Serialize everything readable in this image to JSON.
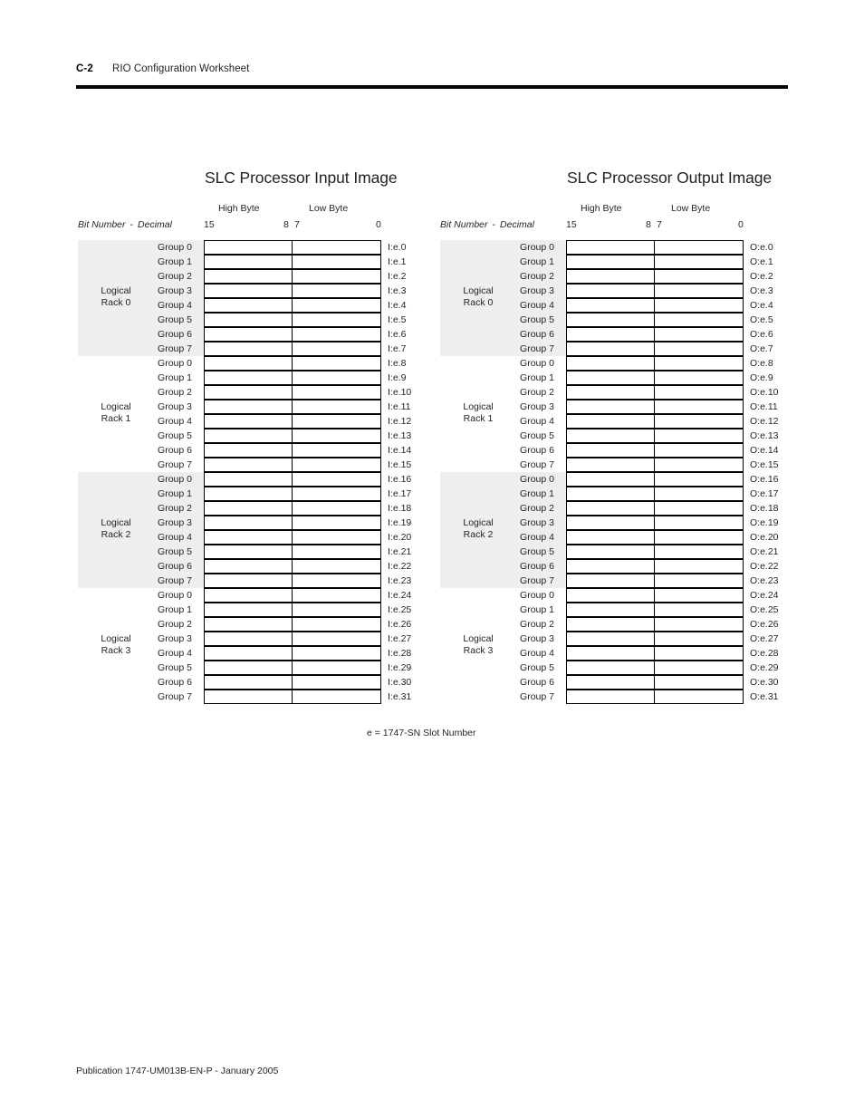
{
  "header": {
    "page_number": "C-2",
    "title": "RIO Configuration Worksheet"
  },
  "sheets": [
    {
      "key": "input",
      "title": "SLC Processor Input Image",
      "high_byte_label": "High Byte",
      "low_byte_label": "Low Byte",
      "bit_number_label": "Bit Number",
      "dash": "-",
      "decimal_label": "Decimal",
      "bit_marks": {
        "left": "15",
        "mid_high": "8",
        "mid_low": "7",
        "right": "0"
      },
      "racks": [
        {
          "label_line1": "Logical",
          "label_line2": "Rack 0",
          "shaded": true,
          "groups": [
            "Group 0",
            "Group 1",
            "Group 2",
            "Group 3",
            "Group 4",
            "Group 5",
            "Group 6",
            "Group 7"
          ],
          "addresses": [
            "I:e.0",
            "I:e.1",
            "I:e.2",
            "I:e.3",
            "I:e.4",
            "I:e.5",
            "I:e.6",
            "I:e.7"
          ]
        },
        {
          "label_line1": "Logical",
          "label_line2": "Rack 1",
          "shaded": false,
          "groups": [
            "Group 0",
            "Group 1",
            "Group 2",
            "Group 3",
            "Group 4",
            "Group 5",
            "Group 6",
            "Group 7"
          ],
          "addresses": [
            "I:e.8",
            "I:e.9",
            "I:e.10",
            "I:e.11",
            "I:e.12",
            "I:e.13",
            "I:e.14",
            "I:e.15"
          ]
        },
        {
          "label_line1": "Logical",
          "label_line2": "Rack 2",
          "shaded": true,
          "groups": [
            "Group 0",
            "Group 1",
            "Group 2",
            "Group 3",
            "Group 4",
            "Group 5",
            "Group 6",
            "Group 7"
          ],
          "addresses": [
            "I:e.16",
            "I:e.17",
            "I:e.18",
            "I:e.19",
            "I:e.20",
            "I:e.21",
            "I:e.22",
            "I:e.23"
          ]
        },
        {
          "label_line1": "Logical",
          "label_line2": "Rack 3",
          "shaded": false,
          "groups": [
            "Group 0",
            "Group 1",
            "Group 2",
            "Group 3",
            "Group 4",
            "Group 5",
            "Group 6",
            "Group 7"
          ],
          "addresses": [
            "I:e.24",
            "I:e.25",
            "I:e.26",
            "I:e.27",
            "I:e.28",
            "I:e.29",
            "I:e.30",
            "I:e.31"
          ]
        }
      ]
    },
    {
      "key": "output",
      "title": "SLC Processor Output Image",
      "high_byte_label": "High Byte",
      "low_byte_label": "Low Byte",
      "bit_number_label": "Bit Number",
      "dash": "-",
      "decimal_label": "Decimal",
      "bit_marks": {
        "left": "15",
        "mid_high": "8",
        "mid_low": "7",
        "right": "0"
      },
      "racks": [
        {
          "label_line1": "Logical",
          "label_line2": "Rack 0",
          "shaded": true,
          "groups": [
            "Group 0",
            "Group 1",
            "Group 2",
            "Group 3",
            "Group 4",
            "Group 5",
            "Group 6",
            "Group 7"
          ],
          "addresses": [
            "O:e.0",
            "O:e.1",
            "O:e.2",
            "O:e.3",
            "O:e.4",
            "O:e.5",
            "O:e.6",
            "O:e.7"
          ]
        },
        {
          "label_line1": "Logical",
          "label_line2": "Rack 1",
          "shaded": false,
          "groups": [
            "Group 0",
            "Group 1",
            "Group 2",
            "Group 3",
            "Group 4",
            "Group 5",
            "Group 6",
            "Group 7"
          ],
          "addresses": [
            "O:e.8",
            "O:e.9",
            "O:e.10",
            "O:e.11",
            "O:e.12",
            "O:e.13",
            "O:e.14",
            "O:e.15"
          ]
        },
        {
          "label_line1": "Logical",
          "label_line2": "Rack 2",
          "shaded": true,
          "groups": [
            "Group 0",
            "Group 1",
            "Group 2",
            "Group 3",
            "Group 4",
            "Group 5",
            "Group 6",
            "Group 7"
          ],
          "addresses": [
            "O:e.16",
            "O:e.17",
            "O:e.18",
            "O:e.19",
            "O:e.20",
            "O:e.21",
            "O:e.22",
            "O:e.23"
          ]
        },
        {
          "label_line1": "Logical",
          "label_line2": "Rack 3",
          "shaded": false,
          "groups": [
            "Group 0",
            "Group 1",
            "Group 2",
            "Group 3",
            "Group 4",
            "Group 5",
            "Group 6",
            "Group 7"
          ],
          "addresses": [
            "O:e.24",
            "O:e.25",
            "O:e.26",
            "O:e.27",
            "O:e.28",
            "O:e.29",
            "O:e.30",
            "O:e.31"
          ]
        }
      ]
    }
  ],
  "footnote": "e = 1747-SN Slot Number",
  "footer": "Publication 1747-UM013B-EN-P - January 2005"
}
